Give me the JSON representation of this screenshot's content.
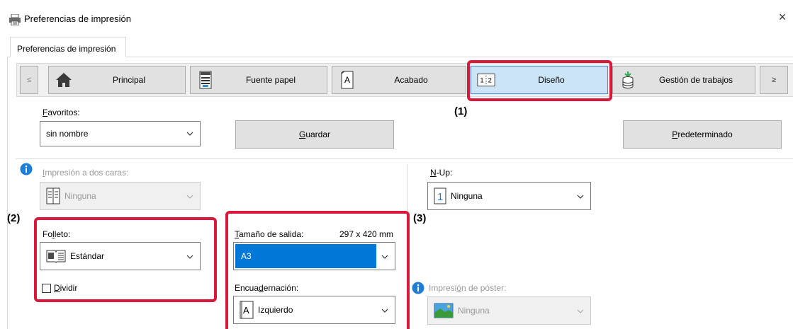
{
  "window": {
    "title": "Preferencias de impresión",
    "close_glyph": "×",
    "icon": "printer-icon"
  },
  "panel_tab": {
    "label": "Preferencias de impresión"
  },
  "nav": {
    "prev_glyph": "≤",
    "next_glyph": "≥",
    "items": [
      {
        "label": "Principal",
        "icon": "home-icon"
      },
      {
        "label": "Fuente papel",
        "icon": "paper-tray-icon"
      },
      {
        "label": "Acabado",
        "icon": "finishing-icon"
      },
      {
        "label": "Diseño",
        "icon": "layout-icon",
        "icon_text": "1¦2",
        "active": true
      },
      {
        "label": "Gestión de trabajos",
        "icon": "job-management-icon"
      }
    ]
  },
  "callouts": {
    "c1": "(1)",
    "c2": "(2)",
    "c3": "(3)"
  },
  "favorites": {
    "label_prefix": "F",
    "label_rest": "avoritos:",
    "value": "sin nombre",
    "save_prefix": "G",
    "save_rest": "uardar",
    "default_prefix": "P",
    "default_rest": "redeterminado"
  },
  "duplex": {
    "label_prefix": "I",
    "label_rest": "mpresión a dos caras:",
    "value": "Ninguna",
    "icon": "duplex-book-icon"
  },
  "nup": {
    "label_prefix": "N",
    "label_rest": "-Up:",
    "value": "Ninguna",
    "icon_text": "1"
  },
  "booklet": {
    "label_a": "Fo",
    "label_u": "l",
    "label_b": "leto:",
    "value": "Estándar",
    "icon": "booklet-icon",
    "split_prefix": "D",
    "split_rest": "ividir",
    "split_checked": false
  },
  "output_size": {
    "label_prefix": "T",
    "label_rest": "amaño de salida:",
    "dimensions": "297 x 420 mm",
    "value": "A3"
  },
  "binding": {
    "label_a": "Encua",
    "label_u": "d",
    "label_b": "ernación:",
    "value": "Izquierdo",
    "icon_text": "A"
  },
  "poster": {
    "label_a": "Impresi",
    "label_u": "ó",
    "label_b": "n de póster:",
    "value": "Ninguna",
    "icon": "poster-image-icon"
  },
  "colors": {
    "highlight_red": "#d8193b",
    "selection_blue": "#0078d7",
    "active_tab_bg": "#cce4f7",
    "info_blue": "#1e7ed6"
  }
}
